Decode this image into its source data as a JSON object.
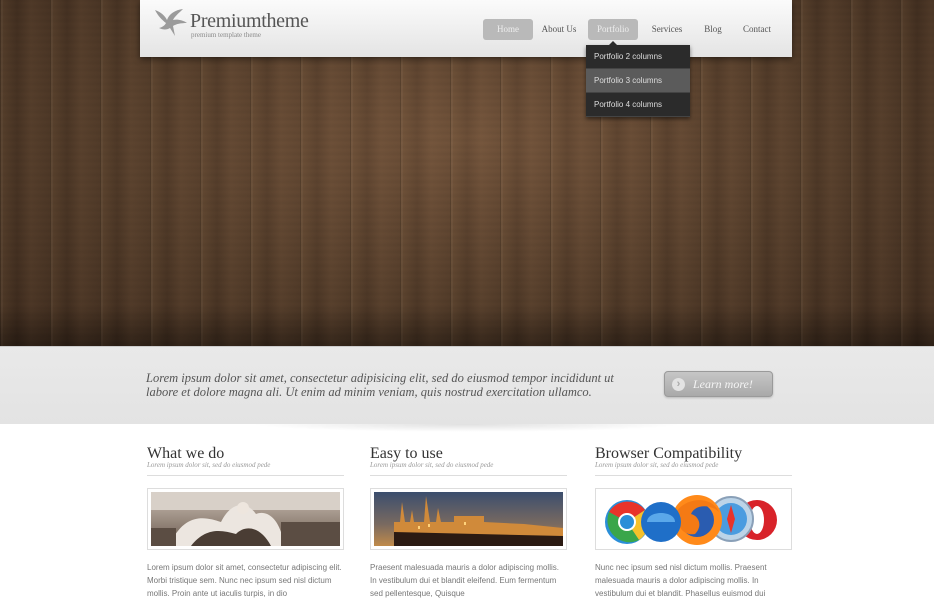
{
  "brand": {
    "title": "Premiumtheme",
    "subtitle": "premium template theme"
  },
  "nav": {
    "items": [
      {
        "label": "Home"
      },
      {
        "label": "About Us"
      },
      {
        "label": "Portfolio"
      },
      {
        "label": "Services"
      },
      {
        "label": "Blog"
      },
      {
        "label": "Contact"
      }
    ],
    "dropdown": [
      {
        "label": "Portfolio 2 columns"
      },
      {
        "label": "Portfolio 3 columns"
      },
      {
        "label": "Portfolio 4 columns"
      }
    ]
  },
  "tagline": {
    "text": "Lorem ipsum dolor sit amet, consectetur adipisicing elit, sed do eiusmod tempor incididunt ut labore et dolore magna ali. Ut enim ad minim veniam, quis nostrud exercitation ullamco.",
    "button_label": "Learn more!"
  },
  "columns": [
    {
      "title": "What we do",
      "subtitle": "Lorem ipsum dolor sit, sed do eiusmod pede",
      "image": "statue-fountain",
      "text": "Lorem ipsum dolor sit amet, consectetur adipiscing elit. Morbi tristique sem. Nunc nec ipsum sed nisl dictum mollis. Proin ante ut iaculis turpis, in dio"
    },
    {
      "title": "Easy to use",
      "subtitle": "Lorem ipsum dolor sit, sed do eiusmod pede",
      "image": "castle-night",
      "text": "Praesent malesuada mauris a dolor adipiscing mollis. In vestibulum dui et blandit eleifend. Eum fermentum sed pellentesque, Quisque"
    },
    {
      "title": "Browser Compatibility",
      "subtitle": "Lorem ipsum dolor sit, sed do eiusmod pede",
      "image": "browser-logos",
      "text": "Nunc nec ipsum sed nisl dictum mollis. Praesent malesuada mauris a dolor adipiscing mollis. In vestibulum dui et blandit. Phasellus euismod dui"
    }
  ],
  "colors": {
    "wood": "#5a4330",
    "nav_active": "#b9b9b9",
    "dropdown_bg": "#2b2b2b",
    "band_bg": "#e6e6e6"
  }
}
